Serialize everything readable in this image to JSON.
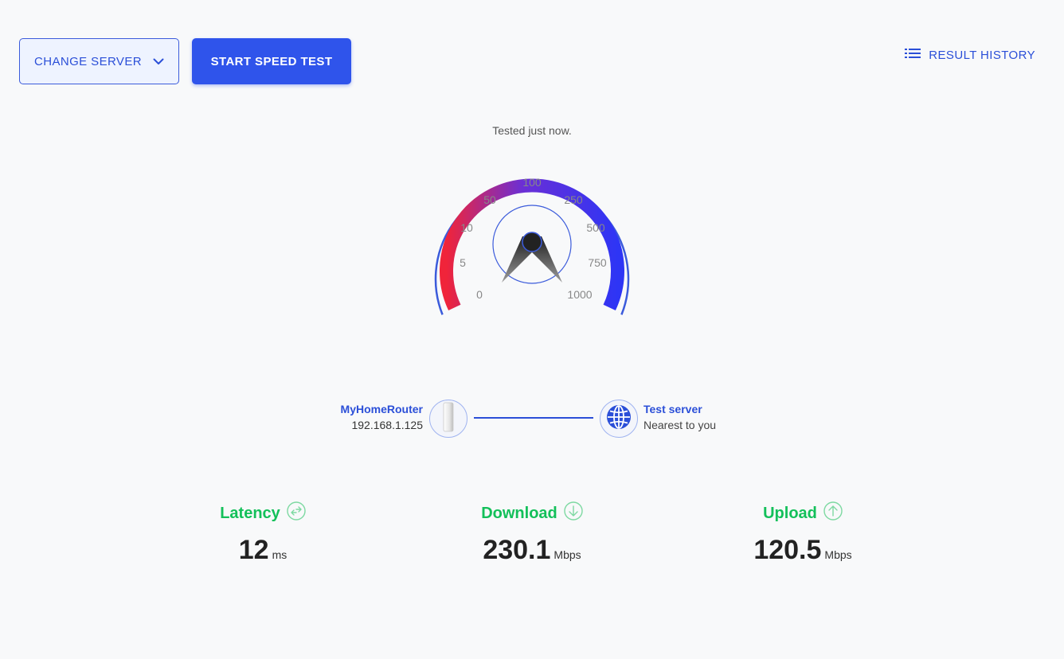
{
  "toolbar": {
    "change_server_label": "CHANGE SERVER",
    "start_test_label": "START SPEED TEST",
    "history_label": "RESULT HISTORY"
  },
  "gauge": {
    "status": "Tested just now.",
    "ticks": [
      "0",
      "5",
      "10",
      "50",
      "100",
      "250",
      "500",
      "750",
      "1000"
    ],
    "needle_value_mbps": 0,
    "colors": {
      "low": "#f0243a",
      "mid": "#6a2fd6",
      "high": "#2e35f5",
      "ring": "#3b5bdb"
    }
  },
  "connection": {
    "router_name": "MyHomeRouter",
    "router_ip": "192.168.1.125",
    "server_name": "Test server",
    "server_desc": "Nearest to you"
  },
  "metrics": {
    "latency": {
      "label": "Latency",
      "value": "12",
      "unit": "ms"
    },
    "download": {
      "label": "Download",
      "value": "230.1",
      "unit": "Mbps"
    },
    "upload": {
      "label": "Upload",
      "value": "120.5",
      "unit": "Mbps"
    }
  },
  "colors": {
    "accent": "#2f54eb",
    "good": "#13c05a"
  }
}
